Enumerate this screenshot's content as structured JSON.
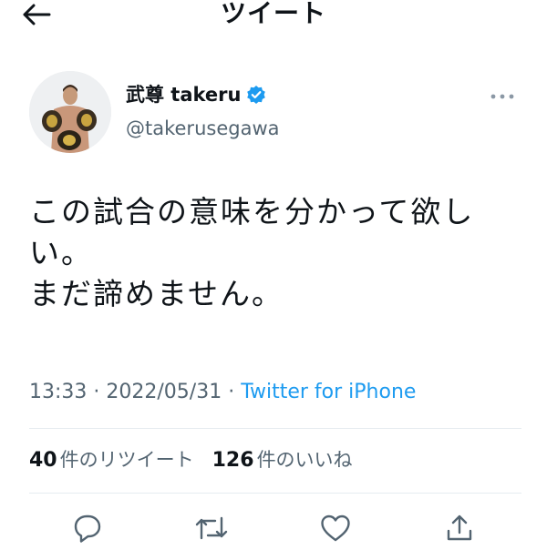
{
  "header": {
    "title": "ツイート",
    "back_icon": "arrow-left-icon"
  },
  "author": {
    "display_name": "武尊 takeru",
    "handle": "@takerusegawa",
    "verified_icon": "verified-badge-icon",
    "more_icon": "more-horizontal-icon"
  },
  "tweet": {
    "text": "この試合の意味を分かって欲しい。\nまだ諦めません。"
  },
  "meta": {
    "time": "13:33",
    "separator": " · ",
    "date": "2022/05/31",
    "source": "Twitter for iPhone"
  },
  "stats": {
    "retweets_count": "40",
    "retweets_label": "件のリツイート",
    "likes_count": "126",
    "likes_label": "件のいいね"
  },
  "actions": {
    "reply_icon": "reply-icon",
    "retweet_icon": "retweet-icon",
    "like_icon": "heart-icon",
    "share_icon": "share-icon"
  },
  "colors": {
    "accent": "#1d9bf0",
    "text": "#0f1419",
    "secondary": "#536471",
    "divider": "#e6ecf0"
  }
}
